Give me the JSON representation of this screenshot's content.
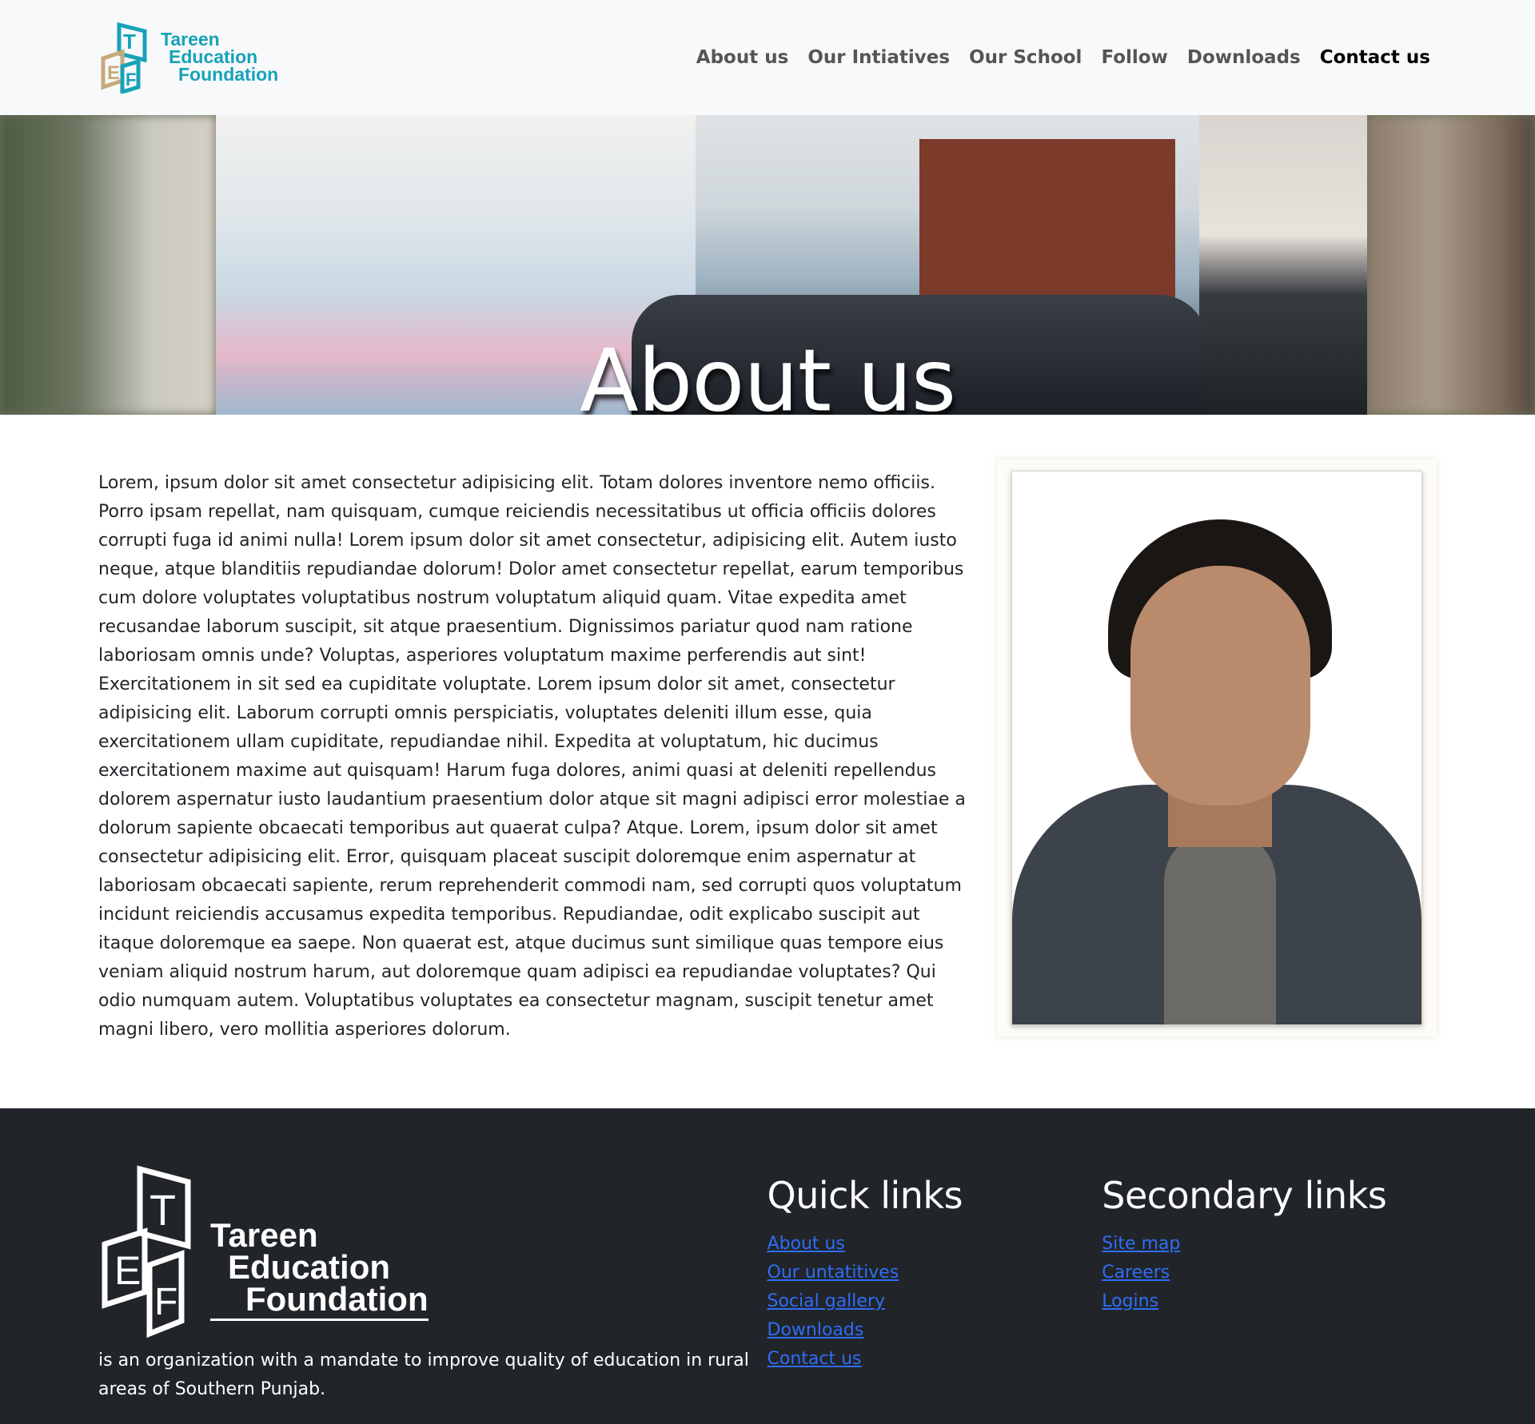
{
  "brand": {
    "logo_letters": [
      "T",
      "E",
      "F"
    ],
    "name_lines": [
      "Tareen",
      "Education",
      "Foundation"
    ],
    "color": "#17a2b8",
    "accent_color": "#c8a97a"
  },
  "nav": {
    "items": [
      {
        "label": "About us",
        "active": false
      },
      {
        "label": "Our Intiatives",
        "active": false
      },
      {
        "label": "Our School",
        "active": false
      },
      {
        "label": "Follow",
        "active": false
      },
      {
        "label": "Downloads",
        "active": false
      },
      {
        "label": "Contact us",
        "active": true
      }
    ]
  },
  "hero": {
    "title": "About us"
  },
  "about": {
    "text": "Lorem, ipsum dolor sit amet consectetur adipisicing elit. Totam dolores inventore nemo officiis. Porro ipsam repellat, nam quisquam, cumque reiciendis necessitatibus ut officia officiis dolores corrupti fuga id animi nulla! Lorem ipsum dolor sit amet consectetur, adipisicing elit. Autem iusto neque, atque blanditiis repudiandae dolorum! Dolor amet consectetur repellat, earum temporibus cum dolore voluptates voluptatibus nostrum voluptatum aliquid quam. Vitae expedita amet recusandae laborum suscipit, sit atque praesentium. Dignissimos pariatur quod nam ratione laboriosam omnis unde? Voluptas, asperiores voluptatum maxime perferendis aut sint! Exercitationem in sit sed ea cupiditate voluptate. Lorem ipsum dolor sit amet, consectetur adipisicing elit. Laborum corrupti omnis perspiciatis, voluptates deleniti illum esse, quia exercitationem ullam cupiditate, repudiandae nihil. Expedita at voluptatum, hic ducimus exercitationem maxime aut quisquam! Harum fuga dolores, animi quasi at deleniti repellendus dolorem aspernatur iusto laudantium praesentium dolor atque sit magni adipisci error molestiae a dolorum sapiente obcaecati temporibus aut quaerat culpa? Atque. Lorem, ipsum dolor sit amet consectetur adipisicing elit. Error, quisquam placeat suscipit doloremque enim aspernatur at laboriosam obcaecati sapiente, rerum reprehenderit commodi nam, sed corrupti quos voluptatum incidunt reiciendis accusamus expedita temporibus. Repudiandae, odit explicabo suscipit aut itaque doloremque ea saepe. Non quaerat est, atque ducimus sunt similique quas tempore eius veniam aliquid nostrum harum, aut doloremque quam adipisci ea repudiandae voluptates? Qui odio numquam autem. Voluptatibus voluptates ea consectetur magnam, suscipit tenetur amet magni libero, vero mollitia asperiores dolorum."
  },
  "footer": {
    "logo_letters": [
      "T",
      "E",
      "F"
    ],
    "name_lines": [
      "Tareen",
      "Education",
      "Foundation"
    ],
    "description": "is an organization with a mandate to improve quality of education in rural areas of Southern Punjab.",
    "quick_links": {
      "title": "Quick links",
      "items": [
        "About us",
        "Our untatitives",
        "Social gallery",
        "Downloads",
        "Contact us"
      ]
    },
    "secondary_links": {
      "title": "Secondary links",
      "items": [
        "Site map",
        "Careers",
        "Logins"
      ]
    },
    "link_color": "#2f6df6",
    "background": "#212529"
  }
}
